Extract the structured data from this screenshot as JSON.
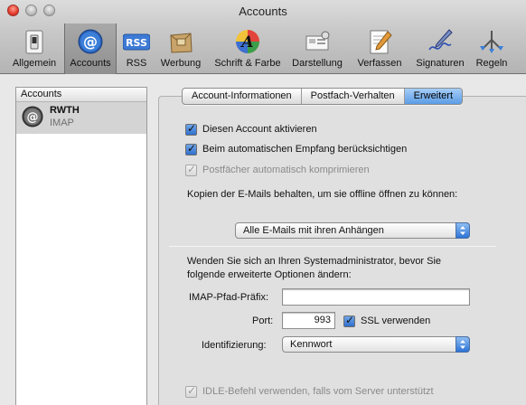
{
  "window": {
    "title": "Accounts"
  },
  "toolbar": {
    "items": [
      {
        "label": "Allgemein",
        "icon": "switch-icon"
      },
      {
        "label": "Accounts",
        "icon": "at-icon"
      },
      {
        "label": "RSS",
        "icon": "rss-icon"
      },
      {
        "label": "Werbung",
        "icon": "junk-mail-icon"
      },
      {
        "label": "Schrift & Farbe",
        "icon": "font-color-icon"
      },
      {
        "label": "Darstellung",
        "icon": "viewing-icon"
      },
      {
        "label": "Verfassen",
        "icon": "compose-icon"
      },
      {
        "label": "Signaturen",
        "icon": "signature-icon"
      },
      {
        "label": "Regeln",
        "icon": "rules-icon"
      }
    ],
    "rss_badge": "RSS",
    "selected": "Accounts"
  },
  "sidebar": {
    "header": "Accounts",
    "accounts": [
      {
        "name": "RWTH",
        "type": "IMAP"
      }
    ]
  },
  "tabs": [
    {
      "label": "Account-Informationen",
      "active": false
    },
    {
      "label": "Postfach-Verhalten",
      "active": false
    },
    {
      "label": "Erweitert",
      "active": true
    }
  ],
  "advanced": {
    "enable_account": {
      "label": "Diesen Account aktivieren",
      "checked": true
    },
    "include_auto_fetch": {
      "label": "Beim automatischen Empfang berücksichtigen",
      "checked": true
    },
    "compact_mailboxes": {
      "label": "Postfächer automatisch komprimieren",
      "checked": true,
      "disabled": true
    },
    "offline_copies_label": "Kopien der E-Mails behalten, um sie offline öffnen zu können:",
    "offline_copies_value": "Alle E-Mails mit ihren Anhängen",
    "admin_note_line1": "Wenden Sie sich an Ihren Systemadministrator, bevor Sie",
    "admin_note_line2": "folgende erweiterte Optionen ändern:",
    "imap_prefix_label": "IMAP-Pfad-Präfix:",
    "imap_prefix_value": "",
    "port_label": "Port:",
    "port_value": "993",
    "ssl": {
      "label": "SSL verwenden",
      "checked": true
    },
    "auth_label": "Identifizierung:",
    "auth_value": "Kennwort",
    "idle": {
      "label": "IDLE-Befehl verwenden, falls vom Server unterstützt",
      "checked": true,
      "disabled": true
    }
  },
  "colors": {
    "accent_blue": "#3b7fd9",
    "selected_row": "#d4d4d4"
  }
}
